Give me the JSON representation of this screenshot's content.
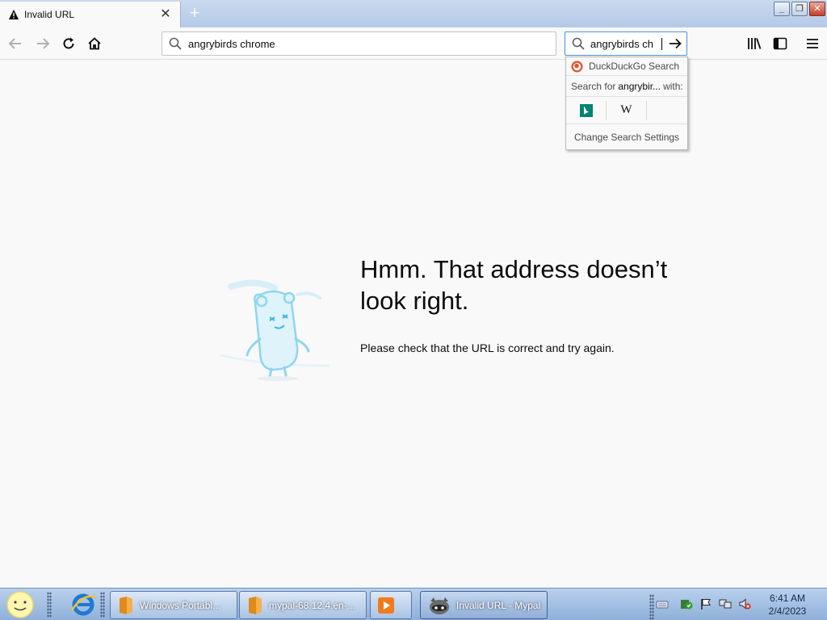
{
  "tab": {
    "title": "Invalid URL",
    "close_icon": "close-icon",
    "new_tab_symbol": "+"
  },
  "window_controls": {
    "minimize": "",
    "maximize": "",
    "close": ""
  },
  "navbar": {
    "url_value": "angrybirds chrome",
    "search_value": "angrybirds ch"
  },
  "search_popup": {
    "engine_name": "DuckDuckGo Search",
    "search_for_prefix": "Search for",
    "search_for_term": "angrybir...",
    "search_for_suffix": "with:",
    "other_engines": [
      "bing",
      "wikipedia"
    ],
    "wikipedia_glyph": "W",
    "settings_label": "Change Search Settings"
  },
  "error_page": {
    "title": "Hmm. That address doesn’t look right.",
    "description": "Please check that the URL is correct and try again."
  },
  "taskbar": {
    "buttons": [
      {
        "label": "Windows Portabl..."
      },
      {
        "label": "mypal-68.12.4.en-..."
      },
      {
        "label": ""
      },
      {
        "label": "Invalid URL - Mypal"
      }
    ],
    "clock_time": "6:41 AM",
    "clock_date": "2/4/2023"
  },
  "colors": {
    "accent": "#4a90d9",
    "bing": "#008373",
    "ddg": "#de5833",
    "illustration": "#8fd6f0"
  }
}
